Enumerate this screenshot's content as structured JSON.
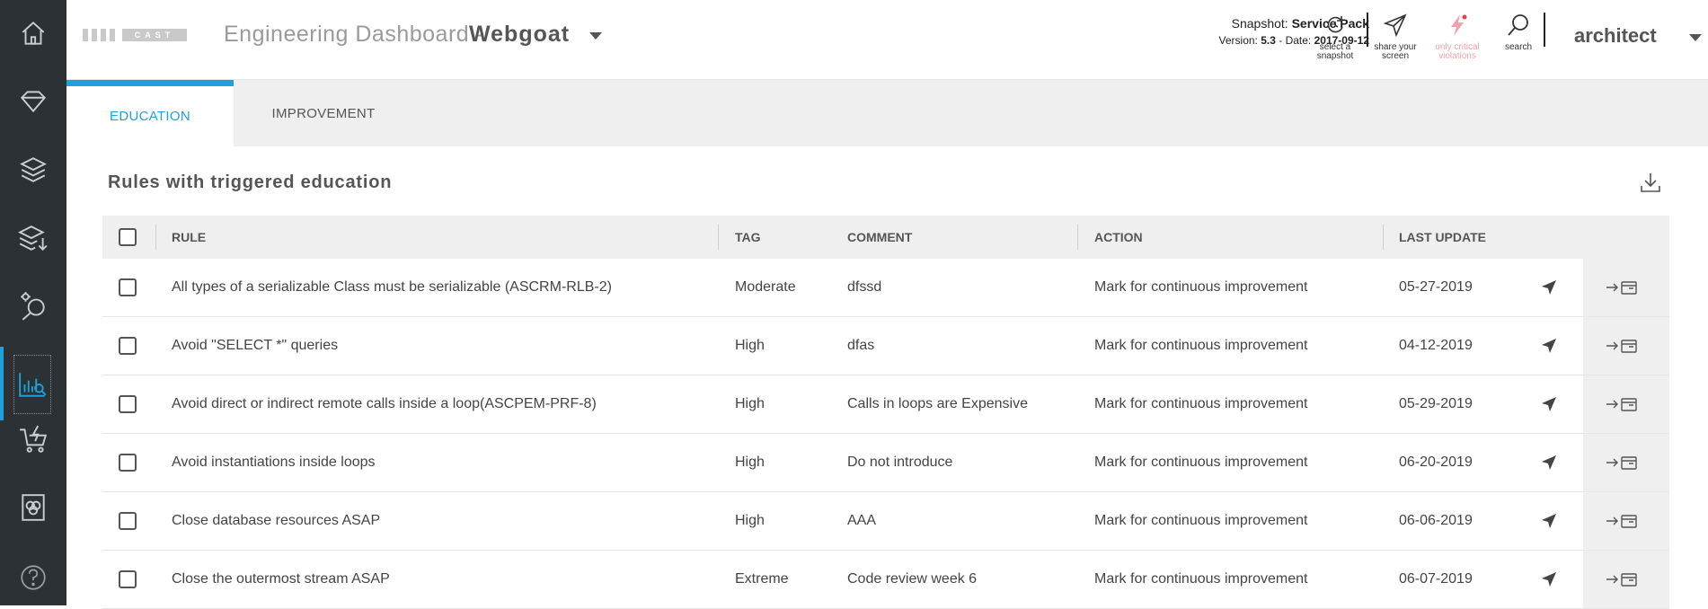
{
  "sidebar": {
    "items": [
      {
        "name": "home-icon"
      },
      {
        "name": "diamond-icon"
      },
      {
        "name": "layers-icon"
      },
      {
        "name": "layers-download-icon"
      },
      {
        "name": "search-analysis-icon"
      },
      {
        "name": "chart-search-icon",
        "active": true
      },
      {
        "name": "cart-lightning-icon"
      },
      {
        "name": "report-icon"
      },
      {
        "name": "help-icon"
      }
    ]
  },
  "header": {
    "logo_text": "CAST",
    "title": "Engineering Dashboard -",
    "app_name": "Webgoat",
    "snapshot_label": "Snapshot:",
    "snapshot_value": "Service Pack",
    "version_label": "Version:",
    "version_value": "5.3",
    "date_label": "- Date:",
    "date_value": "2017-09-12",
    "tools": {
      "select_snapshot": "select a snapshot",
      "share_screen": "share your screen",
      "critical": "only critical violations",
      "search": "search"
    },
    "user": "architect"
  },
  "tabs": [
    {
      "label": "EDUCATION"
    },
    {
      "label": "IMPROVEMENT"
    }
  ],
  "section": {
    "title": "Rules with triggered education"
  },
  "table": {
    "columns": {
      "rule": "RULE",
      "tag": "TAG",
      "comment": "COMMENT",
      "action": "ACTION",
      "last_update": "LAST UPDATE"
    },
    "rows": [
      {
        "rule": "All types of a serializable Class must be serializable (ASCRM-RLB-2)",
        "tag": "Moderate",
        "comment": "dfssd",
        "action": "Mark for continuous improvement",
        "last_update": "05-27-2019"
      },
      {
        "rule": "Avoid \"SELECT *\" queries",
        "tag": "High",
        "comment": "dfas",
        "action": "Mark for continuous improvement",
        "last_update": "04-12-2019"
      },
      {
        "rule": "Avoid direct or indirect remote calls inside a loop(ASCPEM-PRF-8)",
        "tag": "High",
        "comment": "Calls in loops are Expensive",
        "action": "Mark for continuous improvement",
        "last_update": "05-29-2019"
      },
      {
        "rule": "Avoid instantiations inside loops",
        "tag": "High",
        "comment": "Do not introduce",
        "action": "Mark for continuous improvement",
        "last_update": "06-20-2019"
      },
      {
        "rule": "Close database resources ASAP",
        "tag": "High",
        "comment": "AAA",
        "action": "Mark for continuous improvement",
        "last_update": "06-06-2019"
      },
      {
        "rule": "Close the outermost stream ASAP",
        "tag": "Extreme",
        "comment": "Code review week 6",
        "action": "Mark for continuous improvement",
        "last_update": "06-07-2019"
      }
    ]
  },
  "colors": {
    "sidebar_bg": "#2b3134",
    "accent": "#1ea0d8",
    "disabled": "#f0a3ab"
  }
}
